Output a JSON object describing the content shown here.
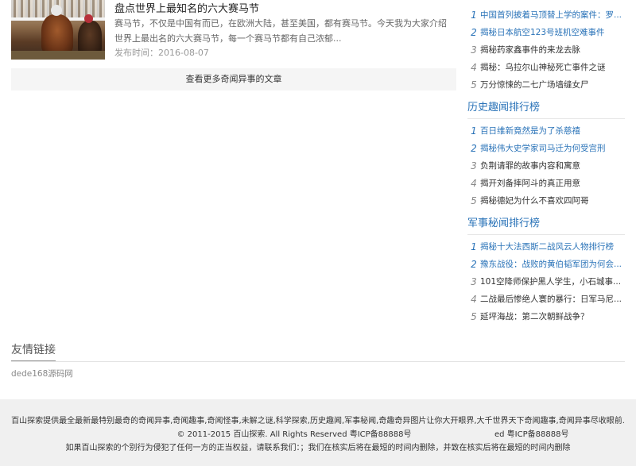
{
  "article": {
    "title": "盘点世界上最知名的六大赛马节",
    "desc": "赛马节，不仅是中国有而已，在欧洲大陆，甚至美国，都有赛马节。今天我为大家介绍世界上最出名的六大赛马节，每一个赛马节都有自己浓郁...",
    "date": "发布时间：2016-08-07"
  },
  "more_link": "查看更多奇闻异事的文章",
  "top_list": {
    "items": [
      {
        "num": "1",
        "text": "中国首列披着马顶替上学的案件：罗..."
      },
      {
        "num": "2",
        "text": "揭秘日本航空123号班机空难事件"
      },
      {
        "num": "3",
        "text": "揭秘药家鑫事件的来龙去脉"
      },
      {
        "num": "4",
        "text": "揭秘：乌拉尔山神秘死亡事件之谜"
      },
      {
        "num": "5",
        "text": "万分惊悚的二七广场墙缝女尸"
      }
    ]
  },
  "history": {
    "title": "历史趣闻排行榜",
    "items": [
      {
        "num": "1",
        "text": "百日维新竟然是为了杀慈禧"
      },
      {
        "num": "2",
        "text": "揭秘伟大史学家司马迁为何受宫刑"
      },
      {
        "num": "3",
        "text": "负荆请罪的故事内容和寓意"
      },
      {
        "num": "4",
        "text": "揭开刘备摔阿斗的真正用意"
      },
      {
        "num": "5",
        "text": "揭秘德妃为什么不喜欢四阿哥"
      }
    ]
  },
  "military": {
    "title": "军事秘闻排行榜",
    "items": [
      {
        "num": "1",
        "text": "揭秘十大法西斯二战风云人物排行榜"
      },
      {
        "num": "2",
        "text": "豫东战役：战败的黄伯韬军团为何会..."
      },
      {
        "num": "3",
        "text": "101空降师保护黑人学生，小石城事..."
      },
      {
        "num": "4",
        "text": "二战最后惨绝人寰的暴行：日军马尼..."
      },
      {
        "num": "5",
        "text": "延坪海战：第二次朝鲜战争？"
      }
    ]
  },
  "links": {
    "title": "友情链接",
    "items": [
      "dede168源码网"
    ]
  },
  "footer": {
    "line1": "百山探索提供最全最新最特别最奇的奇闻异事,奇闻趣事,奇闻怪事,未解之谜,科学探索,历史趣闻,军事秘闻,奇趣奇异图片让你大开眼界,大千世界天下奇闻趣事,奇闻异事尽收眼前.",
    "line2": "© 2011-2015 百山探索. All Rights Reserved 粤ICP备88888号",
    "line2b": "ed 粤ICP备88888号",
    "line3": "如果百山探索的个别行为侵犯了任何一方的正当权益，请联系我们：；我们在核实后将在最短的时间内删除，并致在核实后将在最短的时间内删除"
  }
}
